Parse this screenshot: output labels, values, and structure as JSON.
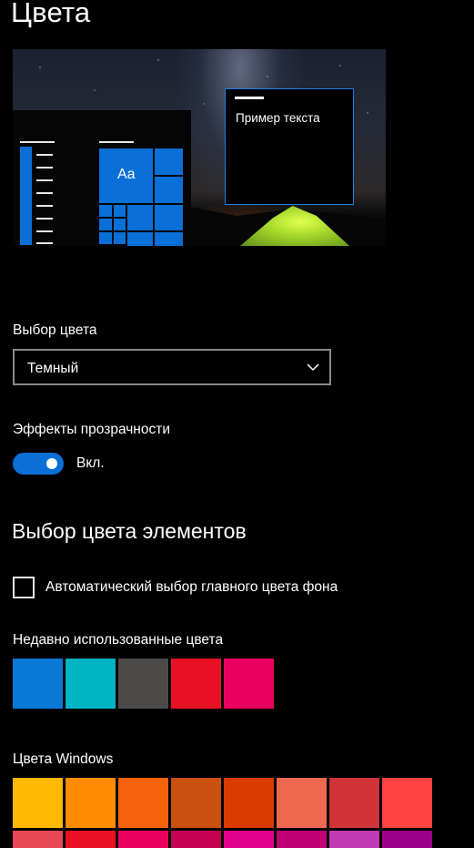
{
  "page": {
    "title": "Цвета"
  },
  "preview": {
    "sample_text": "Пример текста",
    "tile_text": "Aa",
    "accent": "#0A6FD6"
  },
  "color_mode": {
    "label": "Выбор цвета",
    "selected": "Темный",
    "chevron_icon": "chevron-down-icon"
  },
  "transparency": {
    "label": "Эффекты прозрачности",
    "state": "Вкл.",
    "on": true
  },
  "accent": {
    "section_title": "Выбор цвета элементов",
    "auto_checkbox_label": "Автоматический выбор главного цвета фона",
    "auto_checked": false
  },
  "recent_colors": {
    "label": "Недавно использованные цвета",
    "colors": [
      "#0A78D7",
      "#00B4C4",
      "#4C4A48",
      "#E81123",
      "#EA005E"
    ]
  },
  "windows_colors": {
    "label": "Цвета Windows",
    "rows": [
      [
        "#FFB900",
        "#FF8C00",
        "#F7630C",
        "#CA5010",
        "#DA3B01",
        "#EF6950",
        "#D13438",
        "#FF4343"
      ],
      [
        "#E74856",
        "#E81123",
        "#EA005E",
        "#C30052",
        "#E3008C",
        "#BF0077",
        "#C239B3",
        "#9A0089"
      ]
    ]
  }
}
